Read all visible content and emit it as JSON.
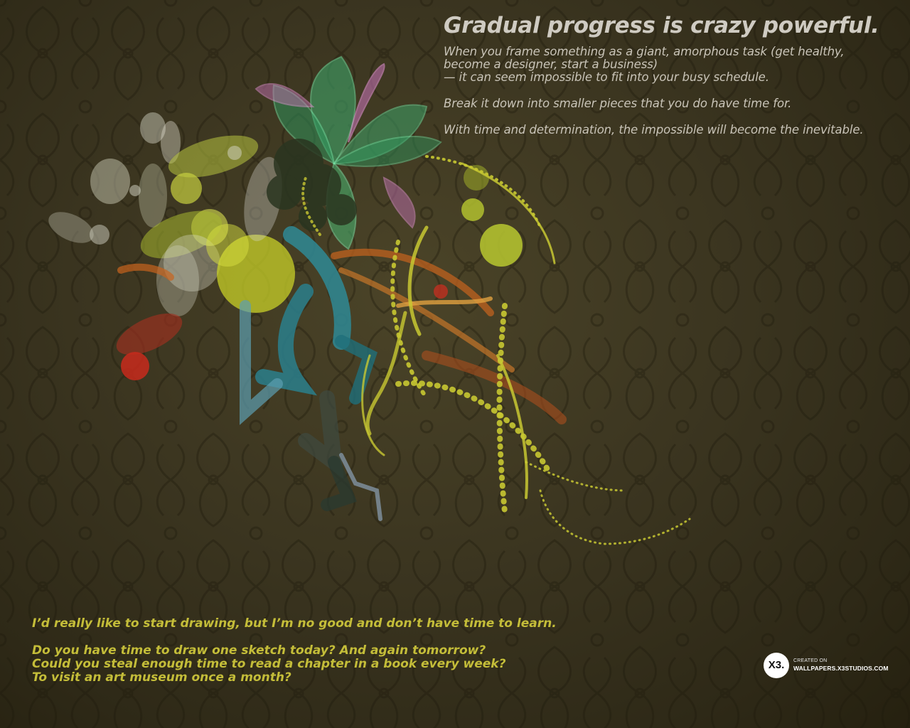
{
  "headline": "Gradual progress is crazy powerful.",
  "body": {
    "line1": "When you frame something as a giant, amorphous task (get healthy,",
    "line2": "become a designer, start a business)",
    "line3": "— it can seem impossible to fit into your busy schedule.",
    "line4": "Break it down into smaller pieces that you do have time for.",
    "line5": "With time and determination, the impossible will become the inevitable."
  },
  "question": {
    "line1": "I’d really like to start drawing, but I’m no good and don’t have time to learn.",
    "line2": "Do you have time to draw one sketch today? And again tomorrow?",
    "line3": "Could you steal enough time to read a chapter in a book every week?",
    "line4": "To visit an art museum once a month?"
  },
  "logo": {
    "mark": "X3.",
    "created_on": "CREATED ON",
    "url": "WALLPAPERS.X3STUDIOS.COM"
  },
  "colors": {
    "background": "#3b3520",
    "headline": "#cfcbc2",
    "body_text": "#c9c4b8",
    "question_text": "#c4bd39",
    "accent_yellow": "#c8c832",
    "accent_teal": "#2f8a95",
    "accent_green": "#49c27a",
    "accent_pink": "#c070b0",
    "accent_red": "#c82a1c",
    "accent_orange": "#c8641e"
  }
}
